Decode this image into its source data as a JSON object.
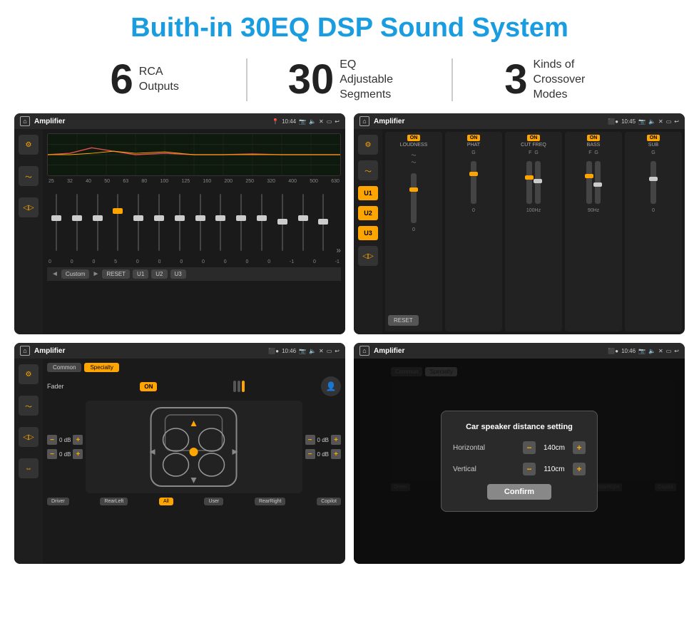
{
  "header": {
    "title": "Buith-in 30EQ DSP Sound System"
  },
  "stats": [
    {
      "number": "6",
      "label": "RCA\nOutputs"
    },
    {
      "number": "30",
      "label": "EQ Adjustable\nSegments"
    },
    {
      "number": "3",
      "label": "Kinds of\nCrossover Modes"
    }
  ],
  "screens": [
    {
      "id": "eq-screen",
      "statusbar": {
        "title": "Amplifier",
        "time": "10:44"
      },
      "type": "equalizer",
      "freqs": [
        "25",
        "32",
        "40",
        "50",
        "63",
        "80",
        "100",
        "125",
        "160",
        "200",
        "250",
        "320",
        "400",
        "500",
        "630"
      ],
      "values": [
        "0",
        "0",
        "0",
        "5",
        "0",
        "0",
        "0",
        "0",
        "0",
        "0",
        "0",
        "-1",
        "0",
        "-1"
      ],
      "buttons": [
        "Custom",
        "RESET",
        "U1",
        "U2",
        "U3"
      ]
    },
    {
      "id": "crossover-screen",
      "statusbar": {
        "title": "Amplifier",
        "time": "10:45"
      },
      "type": "crossover",
      "uButtons": [
        "U1",
        "U2",
        "U3"
      ],
      "modules": [
        {
          "badge": "ON",
          "label": "LOUDNESS"
        },
        {
          "badge": "ON",
          "label": "PHAT"
        },
        {
          "badge": "ON",
          "label": "CUT FREQ"
        },
        {
          "badge": "ON",
          "label": "BASS"
        },
        {
          "badge": "ON",
          "label": "SUB"
        }
      ]
    },
    {
      "id": "fader-screen",
      "statusbar": {
        "title": "Amplifier",
        "time": "10:46"
      },
      "type": "fader",
      "tabs": [
        "Common",
        "Specialty"
      ],
      "activeTab": "Specialty",
      "faderLabel": "Fader",
      "faderOn": "ON",
      "dbValues": [
        {
          "label": "0 dB",
          "side": "left"
        },
        {
          "label": "0 dB",
          "side": "left"
        },
        {
          "label": "0 dB",
          "side": "right"
        },
        {
          "label": "0 dB",
          "side": "right"
        }
      ],
      "locationBtns": [
        "Driver",
        "RearLeft",
        "All",
        "User",
        "RearRight",
        "Copilot"
      ]
    },
    {
      "id": "distance-screen",
      "statusbar": {
        "title": "Amplifier",
        "time": "10:46"
      },
      "type": "distance-dialog",
      "dialog": {
        "title": "Car speaker distance setting",
        "horizontal": {
          "label": "Horizontal",
          "value": "140cm"
        },
        "vertical": {
          "label": "Vertical",
          "value": "110cm"
        },
        "confirmBtn": "Confirm"
      }
    }
  ]
}
